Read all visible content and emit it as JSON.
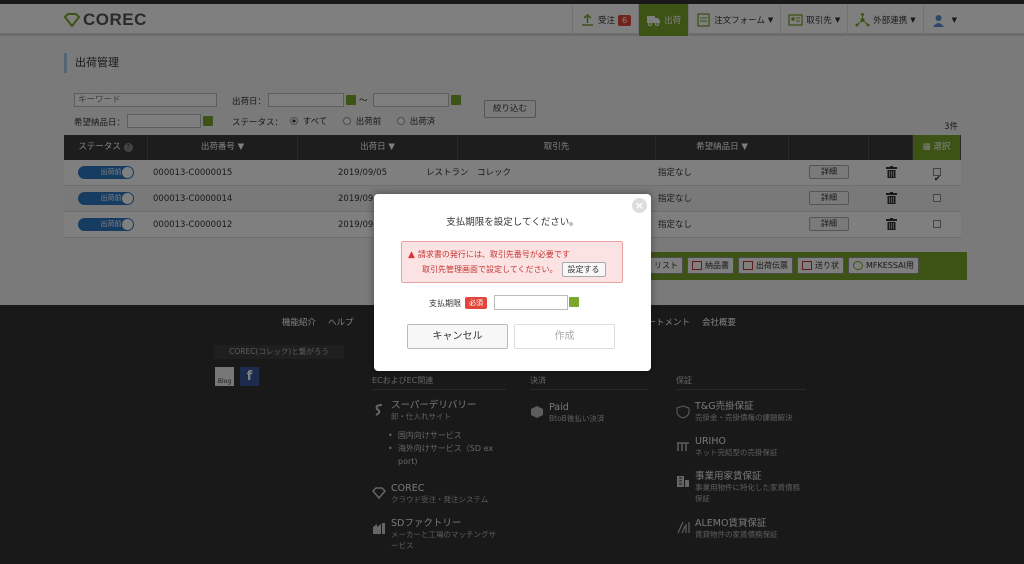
{
  "header": {
    "logo": "COREC",
    "nav": [
      {
        "label": "受注",
        "badge": "6"
      },
      {
        "label": "出荷"
      },
      {
        "label": "注文フォーム"
      },
      {
        "label": "取引先"
      },
      {
        "label": "外部連携"
      }
    ]
  },
  "page_title": "出荷管理",
  "filters": {
    "keyword_placeholder": "キーワード",
    "ship_date_label": "出荷日：",
    "tilde": "〜",
    "desired_date_label": "希望納品日：",
    "status_label": "ステータス：",
    "status_options": [
      "すべて",
      "出荷前",
      "出荷済"
    ],
    "narrow_button": "絞り込む"
  },
  "result_count": "3件",
  "table": {
    "headers": [
      "ステータス",
      "出荷番号 ▼",
      "出荷日 ▼",
      "取引先",
      "希望納品日 ▼",
      "",
      "",
      "選択"
    ],
    "rows": [
      {
        "status": "出荷前",
        "number": "000013-C0000015",
        "date": "2019/09/05",
        "client": "レストラン　コレック",
        "desired": "指定なし",
        "detail": "詳細",
        "checked": true
      },
      {
        "status": "出荷前",
        "number": "000013-C0000014",
        "date": "2019/09",
        "client": "",
        "desired": "指定なし",
        "detail": "詳細",
        "checked": false
      },
      {
        "status": "出荷前",
        "number": "000013-C0000012",
        "date": "2019/09",
        "client": "",
        "desired": "指定なし",
        "detail": "詳細",
        "checked": false
      }
    ]
  },
  "action_bar": [
    "リスト",
    "納品書",
    "出荷伝票",
    "送り状",
    "MFKESSAI用"
  ],
  "footer": {
    "links": [
      "機能紹介",
      "ヘルプ",
      "",
      "ートメント",
      "会社概要"
    ],
    "follow": "COREC(コレック)と繋がろう",
    "sns": [
      "Blog",
      "f"
    ],
    "columns": {
      "ec": "ECおよびEC関連",
      "payment": "決済",
      "guarantee": "保証"
    },
    "services": {
      "super_delivery": {
        "title": "スーパーデリバリー",
        "sub": "卸・仕入れサイト"
      },
      "bullets": [
        "国内向けサービス",
        "海外向けサービス（SD ex",
        "port)"
      ],
      "corec": {
        "title": "COREC",
        "sub": "クラウド受注・発注システム"
      },
      "sd_factory": {
        "title": "SDファクトリー",
        "sub": "メーカーと工場のマッチングサ",
        "sub2": "ービス"
      },
      "paid": {
        "title": "Paid",
        "sub": "BtoB後払い決済"
      },
      "tg": {
        "title": "T&G売掛保証",
        "sub": "売掛金・売掛債権の課題解決"
      },
      "uriho": {
        "title": "URIHO",
        "sub": "ネット完結型の売掛保証"
      },
      "rent": {
        "title": "事業用家賃保証",
        "sub": "事業用物件に特化した家賃債務",
        "sub2": "保証"
      },
      "alemo": {
        "title": "ALEMO賃貸保証",
        "sub": "賃貸物件の家賃債務保証"
      }
    }
  },
  "modal": {
    "title": "支払期限を設定してください。",
    "alert_line1": "請求書の発行には、取引先番号が必要です",
    "alert_line2": "取引先管理画面で設定してください。",
    "alert_button": "設定する",
    "due_label": "支払期限",
    "required": "必須",
    "cancel": "キャンセル",
    "create": "作成",
    "close": "×"
  },
  "colors": {
    "accent": "#7aa72c",
    "toggle": "#2f78c4",
    "danger": "#e2463b"
  }
}
